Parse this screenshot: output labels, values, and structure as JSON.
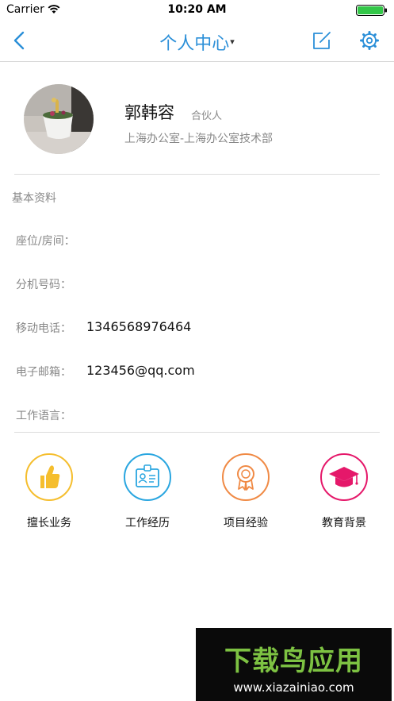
{
  "status_bar": {
    "carrier": "Carrier",
    "time": "10:20 AM"
  },
  "nav": {
    "title": "个人中心",
    "title_caret": "▾",
    "accent_color": "#2b8fd8",
    "icons": [
      "back-chevron-icon",
      "edit-icon",
      "settings-gear-icon"
    ]
  },
  "profile": {
    "name": "郭韩容",
    "role": "合伙人",
    "department": "上海办公室-上海办公室技术部"
  },
  "basic_info": {
    "section_title": "基本资料",
    "fields": [
      {
        "label": "座位/房间：",
        "value": ""
      },
      {
        "label": "分机号码：",
        "value": ""
      },
      {
        "label": "移动电话：",
        "value": "13465689764​64"
      },
      {
        "label": "电子邮箱：",
        "value": "123456@qq.com"
      },
      {
        "label": "工作语言：",
        "value": ""
      }
    ]
  },
  "features": [
    {
      "label": "擅长业务",
      "icon": "thumbs-up-icon",
      "color": "#f5be2e"
    },
    {
      "label": "工作经历",
      "icon": "id-badge-icon",
      "color": "#2aa6e0"
    },
    {
      "label": "项目经验",
      "icon": "award-ribbon-icon",
      "color": "#f08a45"
    },
    {
      "label": "教育背景",
      "icon": "graduation-cap-icon",
      "color": "#e5186a"
    }
  ],
  "watermark": {
    "title": "下载鸟应用",
    "url": "www.xiazainiao.com"
  }
}
